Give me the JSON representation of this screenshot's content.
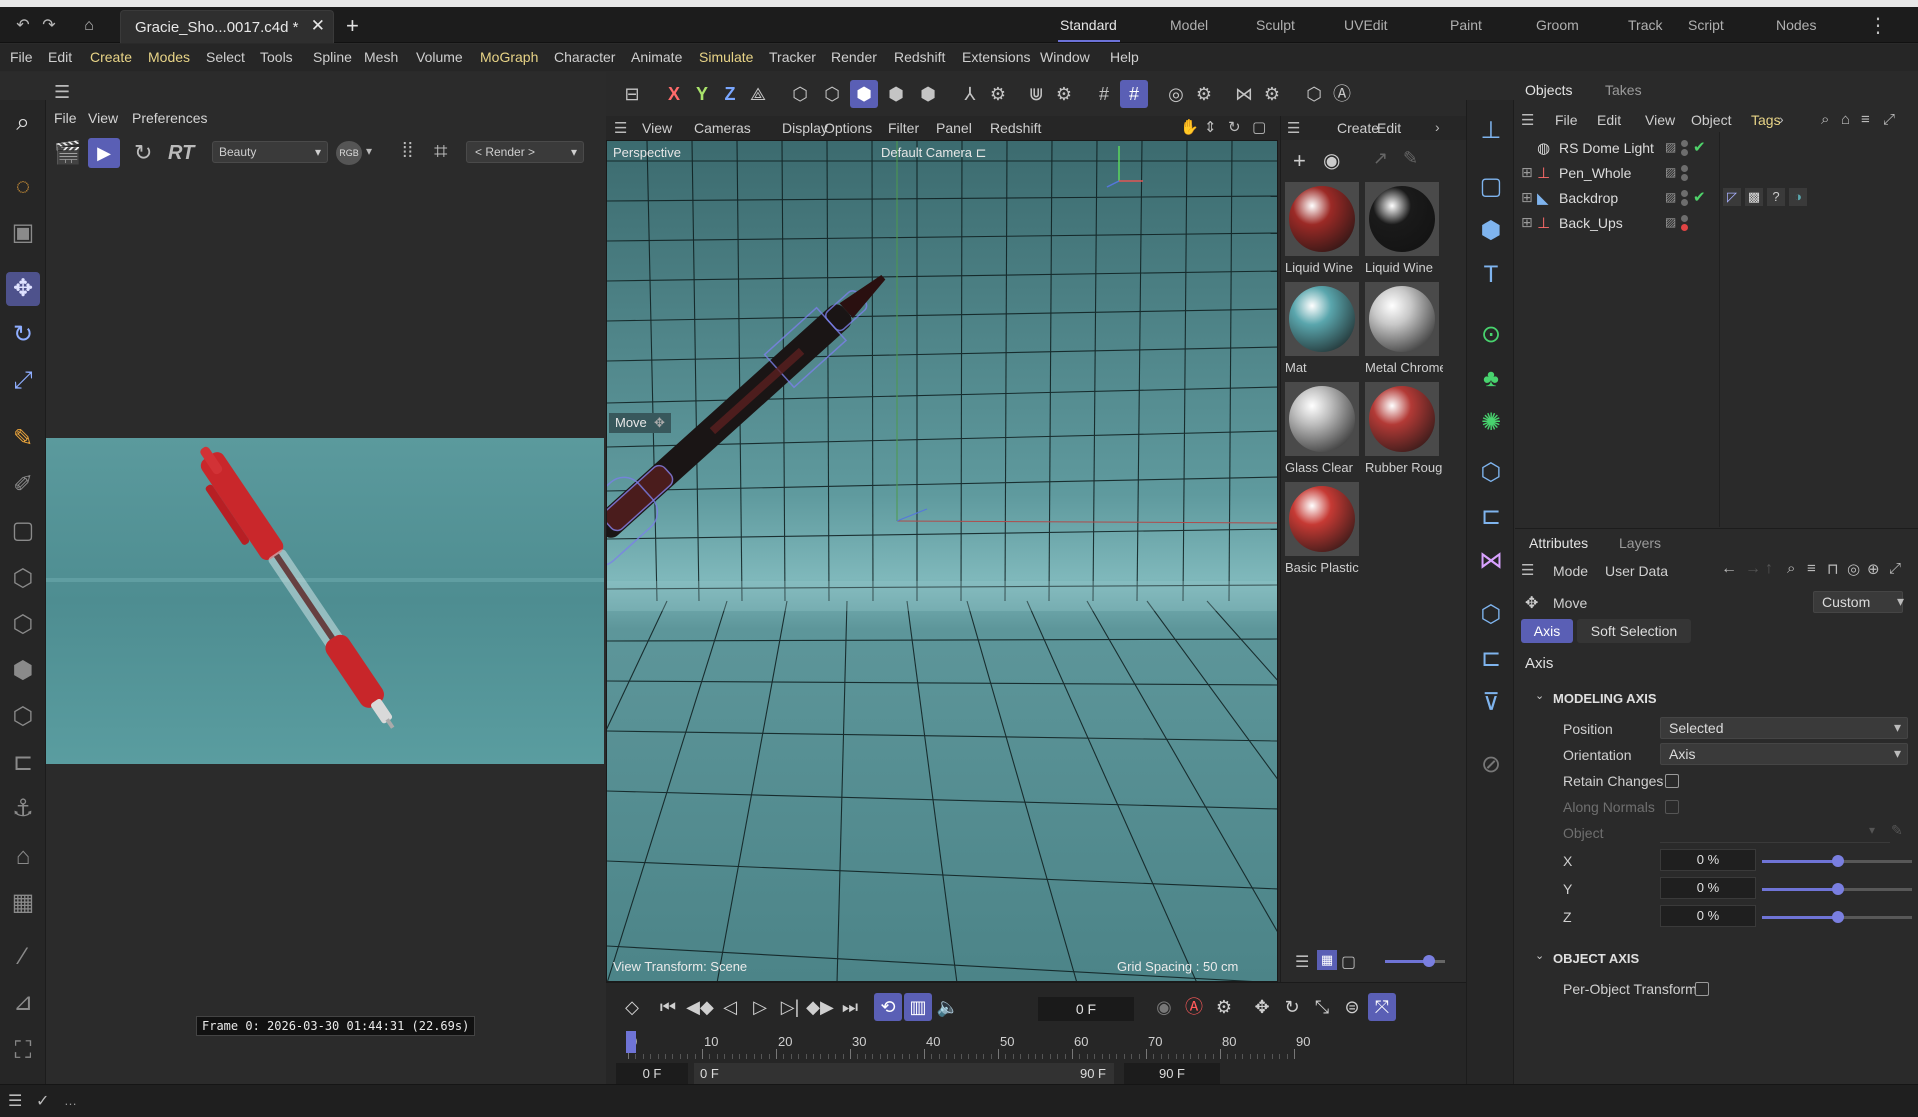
{
  "document_tab": {
    "title": "Gracie_Sho...0017.c4d *"
  },
  "layouts": [
    "Standard",
    "Model",
    "Sculpt",
    "UVEdit",
    "Paint",
    "Groom",
    "Track",
    "Script",
    "Nodes"
  ],
  "active_layout": "Standard",
  "menubar": [
    "File",
    "Edit",
    "Create",
    "Modes",
    "Select",
    "Tools",
    "Spline",
    "Mesh",
    "Volume",
    "MoGraph",
    "Character",
    "Animate",
    "Simulate",
    "Tracker",
    "Render",
    "Redshift",
    "Extensions",
    "Window",
    "Help"
  ],
  "render_view": {
    "menu": [
      "File",
      "View",
      "Preferences"
    ],
    "rt_label": "RT",
    "aov_select": "Beauty",
    "rgb_label": "RGB",
    "render_select": "< Render >",
    "frame_info": "Frame  0: 2026-03-30  01:44:31  (22.69s)"
  },
  "viewport": {
    "menu": [
      "View",
      "Cameras",
      "Display",
      "Options",
      "Filter",
      "Panel",
      "Redshift"
    ],
    "axis_buttons": [
      "X",
      "Y",
      "Z"
    ],
    "label_perspective": "Perspective",
    "label_camera": "Default Camera",
    "move_overlay": "Move",
    "view_transform": "View Transform: Scene",
    "grid_spacing": "Grid Spacing : 50 cm"
  },
  "materials": {
    "menu": [
      "Create",
      "Edit"
    ],
    "items": [
      {
        "name": "Liquid Wine",
        "color": "#9c2a26"
      },
      {
        "name": "Liquid Wine",
        "color": "#1a1a1a"
      },
      {
        "name": "Mat",
        "color": "#5aa6ad"
      },
      {
        "name": "Metal Chrome",
        "color": "#c8c8c8"
      },
      {
        "name": "Glass Clear",
        "color": "#bdbdbd"
      },
      {
        "name": "Rubber Rough",
        "color": "#b33a36"
      },
      {
        "name": "Basic Plastic",
        "color": "#c63a34"
      }
    ]
  },
  "objects": {
    "tabs": [
      "Objects",
      "Takes"
    ],
    "menu": [
      "File",
      "Edit",
      "View",
      "Object",
      "Tags"
    ],
    "items": [
      {
        "name": "RS Dome Light",
        "icon": "globe-icon"
      },
      {
        "name": "Pen_Whole",
        "icon": "null-icon"
      },
      {
        "name": "Backdrop",
        "icon": "backdrop-icon"
      },
      {
        "name": "Back_Ups",
        "icon": "null-icon"
      }
    ]
  },
  "attributes": {
    "tabs": [
      "Attributes",
      "Layers"
    ],
    "menu": [
      "Mode",
      "User Data"
    ],
    "tool_name": "Move",
    "preset": "Custom",
    "subtabs": [
      "Axis",
      "Soft Selection"
    ],
    "heading": "Axis",
    "modeling_axis": {
      "title": "MODELING AXIS",
      "position_label": "Position",
      "position_value": "Selected",
      "orientation_label": "Orientation",
      "orientation_value": "Axis",
      "retain_label": "Retain Changes",
      "along_label": "Along Normals",
      "object_label": "Object",
      "x_label": "X",
      "x_value": "0 %",
      "y_label": "Y",
      "y_value": "0 %",
      "z_label": "Z",
      "z_value": "0 %"
    },
    "object_axis": {
      "title": "OBJECT AXIS",
      "per_object_label": "Per-Object Transform"
    }
  },
  "timeline": {
    "current_frame": "0 F",
    "ruler": [
      "0",
      "10",
      "20",
      "30",
      "40",
      "50",
      "60",
      "70",
      "80",
      "90"
    ],
    "start_frame": "0 F",
    "min_frame": "0 F",
    "max_frame": "90 F",
    "end_frame": "90 F"
  },
  "colors": {
    "accent": "#5a5fb5",
    "highlight": "#e8d487",
    "viewport_bg": "#3e6c70"
  }
}
